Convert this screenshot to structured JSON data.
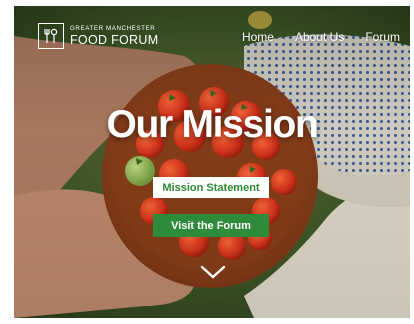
{
  "header": {
    "logo_small": "Greater Manchester",
    "logo_big": "Food Forum",
    "nav": [
      "Home",
      "About Us",
      "Forum"
    ]
  },
  "hero": {
    "title": "Our Mission",
    "statement_button": "Mission Statement",
    "forum_button": "Visit the Forum",
    "scroll_icon": "chevron-down-icon"
  },
  "colors": {
    "accent_green": "#2e8b39",
    "statement_text": "#2f8b33"
  }
}
